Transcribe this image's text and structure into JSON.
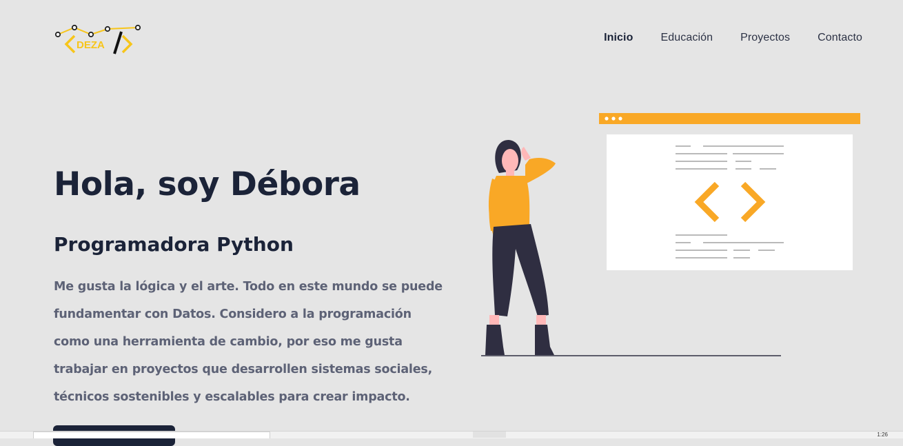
{
  "brand": {
    "logo_text": "DEZA",
    "colors": {
      "yellow": "#f7c51a",
      "dark": "#111111"
    }
  },
  "nav": {
    "items": [
      {
        "label": "Inicio",
        "active": true
      },
      {
        "label": "Educación",
        "active": false
      },
      {
        "label": "Proyectos",
        "active": false
      },
      {
        "label": "Contacto",
        "active": false
      }
    ]
  },
  "hero": {
    "title": "Hola, soy Débora",
    "subtitle": "Programadora Python",
    "description": "Me gusta la lógica y el arte. Todo en este mundo se puede fundamentar con Datos. Considero a la programación como una herramienta de cambio, por eso me gusta trabajar en proyectos que desarrollen sistemas sociales, técnicos sostenibles y escalables para crear impacto.",
    "button_label": ""
  },
  "illustration": {
    "accent_color": "#f9a826",
    "icon": "code-brackets-icon"
  },
  "taskbar": {
    "clock": "1:26"
  },
  "theme": {
    "background": "#e5e5e5",
    "heading": "#1b2338",
    "body_text": "#5d6276"
  }
}
